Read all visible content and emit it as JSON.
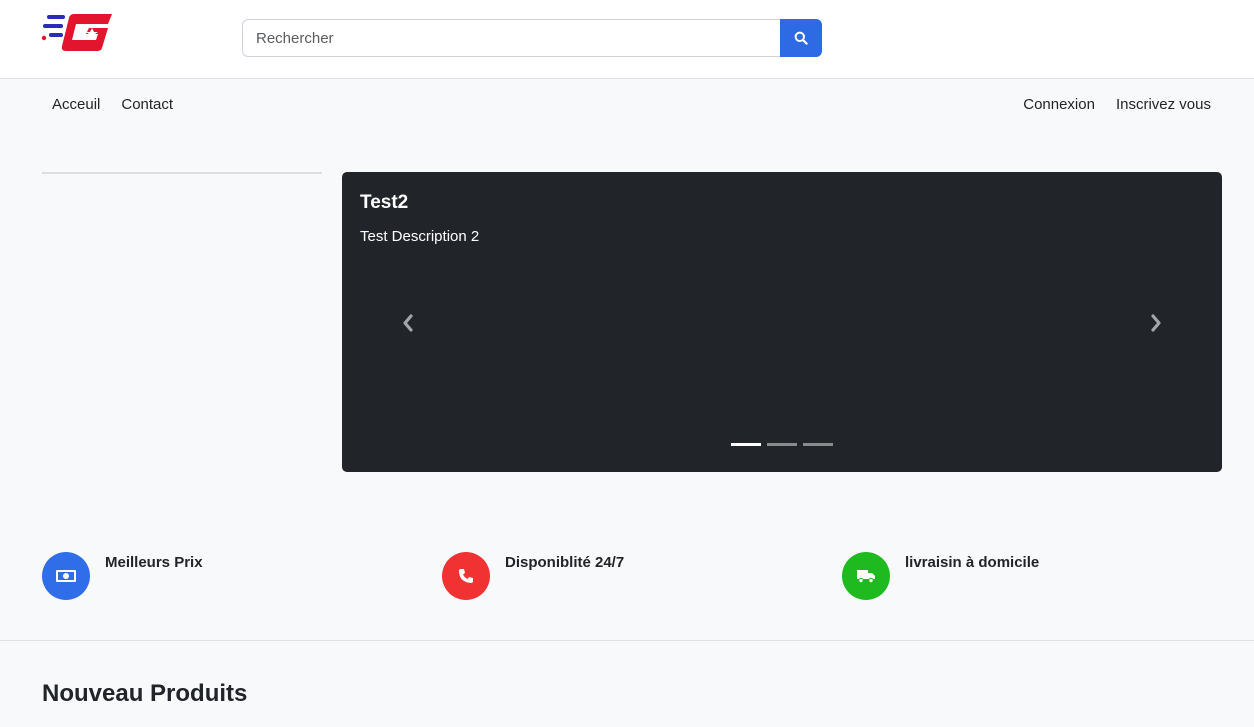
{
  "header": {
    "search": {
      "placeholder": "Rechercher",
      "value": ""
    },
    "search_icon": "search-icon"
  },
  "nav": {
    "left": [
      {
        "label": "Acceuil"
      },
      {
        "label": "Contact"
      }
    ],
    "right": [
      {
        "label": "Connexion"
      },
      {
        "label": "Inscrivez vous"
      }
    ]
  },
  "carousel": {
    "active_slide": {
      "title": "Test2",
      "description": "Test Description 2"
    },
    "indicator_count": 3,
    "active_index": 0,
    "prev_icon": "chevron-left-icon",
    "next_icon": "chevron-right-icon"
  },
  "features": [
    {
      "label": "Meilleurs Prix",
      "icon": "money-bill-icon",
      "color": "#2f6ee8"
    },
    {
      "label": "Disponiblité 24/7",
      "icon": "phone-icon",
      "color": "#f13232"
    },
    {
      "label": "livraisin à domicile",
      "icon": "truck-icon",
      "color": "#1fba1f"
    }
  ],
  "sections": {
    "new_products_title": "Nouveau Produits"
  },
  "colors": {
    "primary": "#2d6ae3",
    "carousel_bg": "#212428",
    "logo_red": "#e3142d",
    "logo_blue": "#2a2bbd"
  }
}
